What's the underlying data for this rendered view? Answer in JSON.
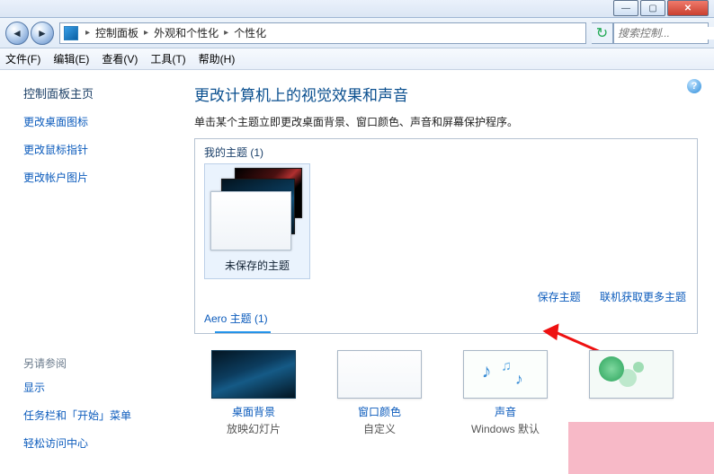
{
  "titlebar": {
    "min": "—",
    "max": "▢",
    "close": "✕"
  },
  "addressbar": {
    "seg1": "控制面板",
    "seg2": "外观和个性化",
    "seg3": "个性化",
    "search_placeholder": "搜索控制..."
  },
  "menu": {
    "file": "文件(F)",
    "edit": "编辑(E)",
    "view": "查看(V)",
    "tools": "工具(T)",
    "help": "帮助(H)"
  },
  "sidebar": {
    "home": "控制面板主页",
    "links": [
      "更改桌面图标",
      "更改鼠标指针",
      "更改帐户图片"
    ],
    "see_also_head": "另请参阅",
    "see_also": [
      "显示",
      "任务栏和「开始」菜单",
      "轻松访问中心"
    ]
  },
  "main": {
    "heading": "更改计算机上的视觉效果和声音",
    "desc": "单击某个主题立即更改桌面背景、窗口颜色、声音和屏幕保护程序。",
    "my_themes_label": "我的主题 (1)",
    "theme_caption": "未保存的主题",
    "save_theme": "保存主题",
    "get_more": "联机获取更多主题",
    "aero_label": "Aero 主题 (1)"
  },
  "settings": {
    "items": [
      {
        "label": "桌面背景",
        "sub": "放映幻灯片"
      },
      {
        "label": "窗口颜色",
        "sub": "自定义"
      },
      {
        "label": "声音",
        "sub": "Windows 默认"
      },
      {
        "label": "",
        "sub": ""
      }
    ]
  }
}
